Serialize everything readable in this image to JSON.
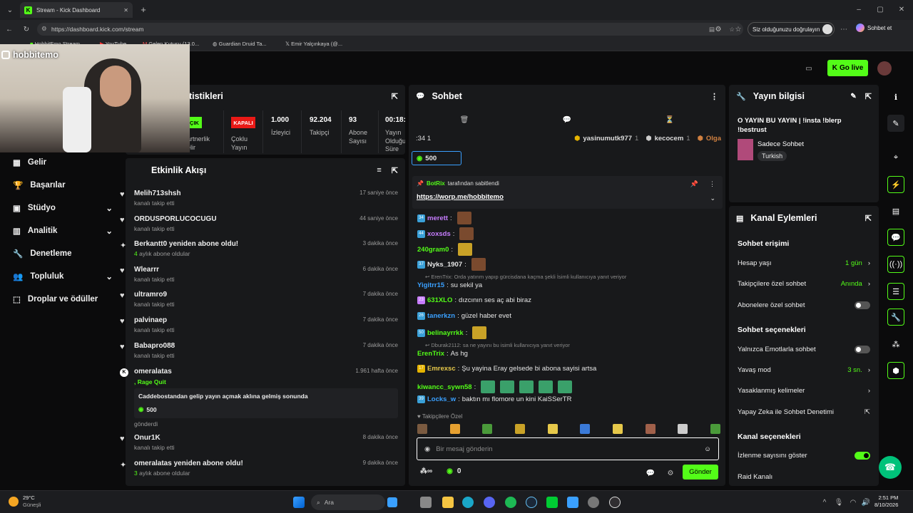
{
  "browser": {
    "tab_title": "Stream - Kick Dashboard",
    "url": "https://dashboard.kick.com/stream",
    "verify_button": "Siz olduğunuzu doğrulayın",
    "copilot": "Sohbet et",
    "bookmarks": [
      "HobbitEmo Stream",
      "YouTube",
      "Gelen Kutusu (13.0...",
      "Guardian Druid Ta...",
      "Emir Yalçınkaya (@..."
    ]
  },
  "webcam": {
    "handle": "hobbitemo"
  },
  "header": {
    "go_live": "Go live"
  },
  "sidebar": {
    "items": [
      "Gelir",
      "Başarılar",
      "Stüdyo",
      "Analitik",
      "Denetleme",
      "Topluluk",
      "Droplar ve ödüller"
    ]
  },
  "stats": {
    "title": "atistikleri",
    "open_label": "ÇIK",
    "cells": [
      {
        "value": "",
        "label": "artnerlik\nelir"
      },
      {
        "value": "KAPALI",
        "label": "Çoklu\nYayın"
      },
      {
        "value": "1.000",
        "label": "İzleyici"
      },
      {
        "value": "92.204",
        "label": "Takipçi"
      },
      {
        "value": "93",
        "label": "Abone\nSayısı"
      },
      {
        "value": "00:18:",
        "label": "Yayın\nOlduğu\nSüre"
      }
    ]
  },
  "feed": {
    "title": "Etkinlik Akışı",
    "items": [
      {
        "name": "Melih713shsh",
        "sub": "kanalı takip etti",
        "time": "17 saniye önce",
        "icon": "heart"
      },
      {
        "name": "ORDUSPORLUCOCUGU",
        "sub": "kanalı takip etti",
        "time": "44 saniye önce",
        "icon": "heart"
      },
      {
        "name": "Berkantt0 yeniden abone oldu!",
        "sub_num": "4",
        "sub": " aylık abone oldular",
        "time": "3 dakika önce",
        "icon": "sparkle"
      },
      {
        "name": "Wlearrr",
        "sub": "kanalı takip etti",
        "time": "6 dakika önce",
        "icon": "heart"
      },
      {
        "name": "ultramro9",
        "sub": "kanalı takip etti",
        "time": "7 dakika önce",
        "icon": "heart"
      },
      {
        "name": "palvinaep",
        "sub": "kanalı takip etti",
        "time": "7 dakika önce",
        "icon": "heart"
      },
      {
        "name": "Babapro088",
        "sub": "kanalı takip etti",
        "time": "7 dakika önce",
        "icon": "heart"
      }
    ],
    "gift": {
      "name": "omeralatas",
      "time": "1.961 hafta önce",
      "tag": ", Rage Quit",
      "message": "Caddebostandan gelip yayın açmak aklına gelmiş sonunda",
      "amount": "500",
      "sent": "gönderdi"
    },
    "items2": [
      {
        "name": "Onur1K",
        "sub": "kanalı takip etti",
        "time": "8 dakika önce",
        "icon": "heart"
      },
      {
        "name": "omeralatas yeniden abone oldu!",
        "sub_num": "3",
        "sub": " aylık abone oldular",
        "time": "9 dakika önce",
        "icon": "sparkle"
      }
    ]
  },
  "chat": {
    "title": "Sohbet",
    "leaders": [
      ":34 1",
      "yasinumutk977",
      "1",
      "kecocem",
      "1",
      "Olga"
    ],
    "kicks": "500",
    "pinned_by": "BotRix",
    "pinned_suffix": "tarafından sabitlendi",
    "pinned_link": "https://worp.me/hobbitemo",
    "messages": [
      {
        "user": "merett",
        "color": "#c77dff",
        "text": "",
        "emote": true,
        "badge": "34"
      },
      {
        "user": "xoxsds",
        "color": "#c77dff",
        "text": "",
        "emote": true,
        "badge": "44"
      },
      {
        "user": "240gram0",
        "color": "#53fc18",
        "text": "",
        "emote": true,
        "badge": ""
      },
      {
        "user": "Nyks_1907",
        "color": "#e6e6e6",
        "text": "",
        "emote": true,
        "badge": "37"
      },
      {
        "user": "Yigitrr15",
        "color": "#3aa0ff",
        "text": "su sekil ya",
        "emote": false,
        "badge": ""
      },
      {
        "user": "631XLO",
        "color": "#53fc18",
        "text": "dızcının ses aç abi biraz",
        "emote": false,
        "badge": "23"
      },
      {
        "user": "tanerkzn",
        "color": "#3aa0ff",
        "text": "güzel haber evet",
        "emote": false,
        "badge": "26"
      },
      {
        "user": "belinayrrkk",
        "color": "#53fc18",
        "text": "",
        "emote": true,
        "badge": "50"
      },
      {
        "user": "ErenTrix",
        "color": "#53fc18",
        "text": "As hg",
        "emote": false,
        "badge": ""
      },
      {
        "user": "Emrexsc",
        "color": "#e6c84a",
        "text": "Şu yayina Eray gelsede bi abona sayisi artsa",
        "emote": false,
        "badge": "17"
      },
      {
        "user": "kiwancc_sywn58",
        "color": "#53fc18",
        "text": "",
        "emote": true,
        "badge": ""
      },
      {
        "user": "Locks_w",
        "color": "#3aa0ff",
        "text": "baktın mı flomore un kini KaiSSerTR",
        "emote": false,
        "badge": "39"
      }
    ],
    "replies": [
      "ErenTrix: Orda yatırım yapıp gürcisdana kaçma şekli İsimli kullanıcıya yanıt veriyor",
      "Dburak2112: sa ne yayını bu isimli kullanıcıya yanıt veriyor"
    ],
    "followers_only": "Takipçilere Özel",
    "placeholder": "Bir mesaj gönderin",
    "points": "0",
    "send": "Gönder"
  },
  "stream_info": {
    "title": "Yayın bilgisi",
    "stream_title": "O YAYIN BU YAYIN | !insta !blerp !bestrust",
    "category": "Sadece Sohbet",
    "tag": "Turkish"
  },
  "channel_actions": {
    "title": "Kanal Eylemleri",
    "sections": {
      "chat_access": "Sohbet erişimi",
      "chat_options": "Sohbet seçenekleri",
      "channel_options": "Kanal seçenekleri"
    },
    "rows": {
      "account_age": {
        "label": "Hesap yaşı",
        "value": "1 gün"
      },
      "followers_only": {
        "label": "Takipçilere özel sohbet",
        "value": "Anında"
      },
      "subs_only": {
        "label": "Abonelere özel sohbet"
      },
      "emote_only": {
        "label": "Yalnızca Emotlarla sohbet"
      },
      "slow_mode": {
        "label": "Yavaş mod",
        "value": "3 sn."
      },
      "banned_words": {
        "label": "Yasaklanmış kelimeler"
      },
      "ai_mod": {
        "label": "Yapay Zeka ile Sohbet Denetimi"
      },
      "show_viewers": {
        "label": "İzlenme sayısını göster"
      },
      "raid": {
        "label": "Raid Kanalı"
      }
    }
  },
  "taskbar": {
    "temp": "29°C",
    "weather": "Güneşli",
    "search": "Ara",
    "time": "2:51 PM",
    "date": "8/10/2026"
  },
  "colors": {
    "accent": "#53fc18",
    "panel": "#18191b",
    "bg": "#0b0b0c"
  }
}
